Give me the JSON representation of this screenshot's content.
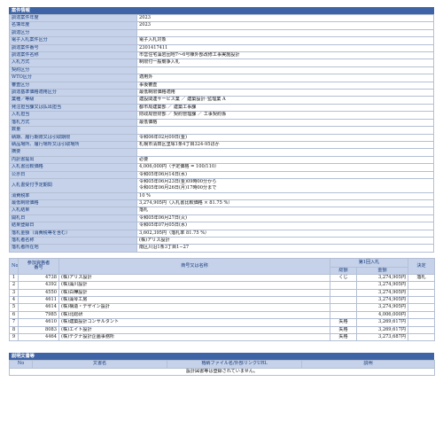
{
  "section_case": "案件情報",
  "info_rows": [
    {
      "k": "調達案件年度",
      "v": "2023"
    },
    {
      "k": "名簿年度",
      "v": "2023"
    },
    {
      "k": "調達区分",
      "v": ""
    },
    {
      "k": "電子入札案件区分",
      "v": "電子入札対象"
    },
    {
      "k": "調達案件番号",
      "v": "2301417411"
    },
    {
      "k": "調達案件名称",
      "v": "市営住宅藻岩団地7〜6号棟外部改修工事実施設計"
    },
    {
      "k": "入札方式",
      "v": "制限付一般競争入札"
    },
    {
      "k": "契約区分",
      "v": ""
    },
    {
      "k": "WTO区分",
      "v": "適用外"
    },
    {
      "k": "審査区分",
      "v": "事後審査"
    },
    {
      "k": "調達基準価格適用区分",
      "v": "最低制限価格適用"
    },
    {
      "k": "業種／等級",
      "v": "建設関連サービス業 ／ 建築設計･監理業 A"
    },
    {
      "k": "発注担当課又は払出担当",
      "v": "都市局建築部 ／ 建築工事課"
    },
    {
      "k": "入札担当",
      "v": "財政局管財部 ／ 契約管理課 ／ 工事契約係"
    },
    {
      "k": "落札方式",
      "v": "最低価格"
    },
    {
      "k": "数量",
      "v": ""
    },
    {
      "k": "納期、履行期限又は引取期限",
      "v": "令和06年02月09日(金)"
    },
    {
      "k": "納品場所、履行場所又は引取場所",
      "v": "札幌市清田区里塚1条4丁目324-95ほか"
    },
    {
      "k": "摘要",
      "v": ""
    },
    {
      "k": "内訳書提出",
      "v": "必要"
    },
    {
      "k": "入札書比較価格",
      "v": "4,006,000円（予定価格 = 100/110）"
    },
    {
      "k": "公示日",
      "v": "令和05年06月14日(水)"
    },
    {
      "k": "入札書受付予定期間",
      "v": "令和05年06月23日(金)09時00分から\n令和05年06月26日(月)17時00分まで",
      "tall": true
    },
    {
      "k": "消費税率",
      "v": "10 %"
    },
    {
      "k": "最低制限価格",
      "v": "3,274,905円（入札書比較価格 × 81.75 %）"
    },
    {
      "k": "入札結果",
      "v": "落札"
    },
    {
      "k": "開札日",
      "v": "令和05年06月27日(火)"
    },
    {
      "k": "結果登録日",
      "v": "令和05年07月05日(水)"
    },
    {
      "k": "落札金額（消費税等を含む）",
      "v": "3,602,395円（落札率 81.75 %）"
    },
    {
      "k": "落札者名称",
      "v": "(株)アリス設計"
    },
    {
      "k": "落札者所在地",
      "v": "南区川沿1条3丁目1−27"
    }
  ],
  "results": {
    "headers": {
      "no": "No",
      "reg": "参加資格者\n番号",
      "name": "商号又は名称",
      "round": "第1回入札",
      "note": "総額",
      "amount": "金額",
      "decision": "決定"
    },
    "rows": [
      {
        "no": "1",
        "reg": "4738",
        "name": "(株)アリス設計",
        "note": "くじ",
        "amount": "3,274,905円",
        "decision": "落札"
      },
      {
        "no": "2",
        "reg": "4392",
        "name": "(株)藻川設計",
        "note": "",
        "amount": "3,274,905円",
        "decision": ""
      },
      {
        "no": "3",
        "reg": "4550",
        "name": "(株)白樺設計",
        "note": "",
        "amount": "3,274,905円",
        "decision": ""
      },
      {
        "no": "4",
        "reg": "4611",
        "name": "(株)藻琴工房",
        "note": "",
        "amount": "3,274,905円",
        "decision": ""
      },
      {
        "no": "5",
        "reg": "4614",
        "name": "(株)構造・デザイン設計",
        "note": "",
        "amount": "3,274,905円",
        "decision": ""
      },
      {
        "no": "6",
        "reg": "7985",
        "name": "(株)北総研",
        "note": "",
        "amount": "4,006,000円",
        "decision": ""
      },
      {
        "no": "7",
        "reg": "4610",
        "name": "(株)建築設計コンサルタント",
        "note": "失格",
        "amount": "3,269,617円",
        "decision": ""
      },
      {
        "no": "8",
        "reg": "8083",
        "name": "(株)エイト設計",
        "note": "失格",
        "amount": "3,269,617円",
        "decision": ""
      },
      {
        "no": "9",
        "reg": "4464",
        "name": "(株)テクナ設計企画事務所",
        "note": "失格",
        "amount": "3,273,687円",
        "decision": ""
      }
    ]
  },
  "doc_section": "説明文書等",
  "doc_headers": {
    "no": "No",
    "name": "文書名",
    "file": "格納ファイル名/外部リンクURL",
    "note": "説明"
  },
  "doc_empty": "設計図書等は登録されていません。"
}
